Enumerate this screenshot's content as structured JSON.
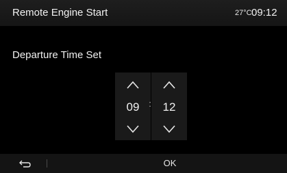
{
  "header": {
    "title": "Remote Engine Start",
    "temperature": "27°C",
    "time": "09:12"
  },
  "content": {
    "label": "Departure Time Set",
    "hours": "09",
    "separator": ":",
    "minutes": "12"
  },
  "footer": {
    "back_icon": "back-arrow-icon",
    "ok_label": "OK"
  },
  "colors": {
    "background": "#000000",
    "header_bg": "#1a1a1a",
    "spinner_bg": "#1a1a1a",
    "footer_bg": "#141414",
    "text": "#f2f2f2"
  }
}
